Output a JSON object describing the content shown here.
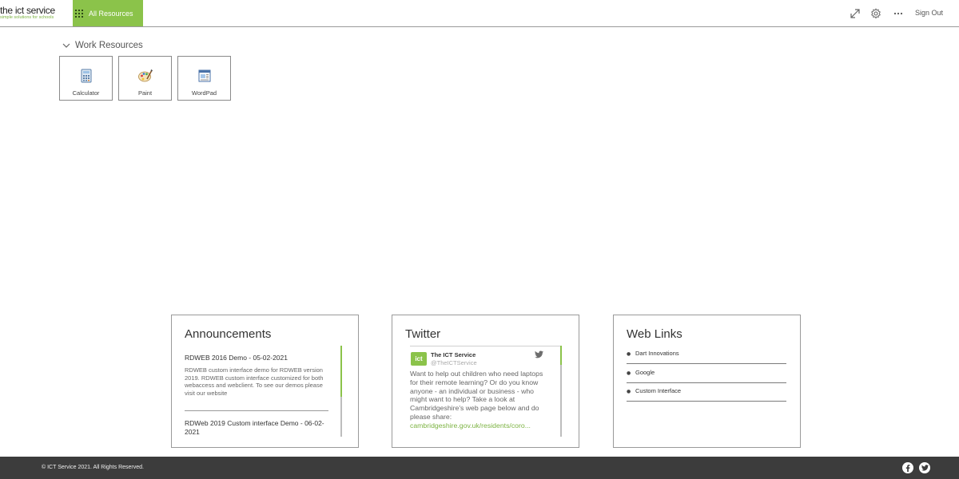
{
  "header": {
    "logo_text": "the ict service",
    "logo_tagline": "simple solutions for schools",
    "all_resources_label": "All Resources",
    "sign_out_label": "Sign Out",
    "icons": [
      "expand-icon",
      "gear-icon",
      "more-icon"
    ]
  },
  "work_resources": {
    "title": "Work Resources",
    "apps": [
      {
        "label": "Calculator",
        "icon": "calculator-icon"
      },
      {
        "label": "Paint",
        "icon": "paint-palette-icon"
      },
      {
        "label": "WordPad",
        "icon": "wordpad-icon"
      }
    ]
  },
  "announcements": {
    "title": "Announcements",
    "items": [
      {
        "title": "RDWEB 2016 Demo - 05-02-2021",
        "text": "RDWEB custom interface demo for RDWEB version 2019. RDWEB custom interface customized for both webaccess and webclient. To see our demos please visit our website"
      },
      {
        "title": "RDWeb 2019 Custom interface Demo - 06-02-2021"
      }
    ]
  },
  "twitter": {
    "title": "Twitter",
    "account_name": "The ICT Service",
    "handle": "@TheICTService",
    "avatar_text": "ict",
    "tweet_text": "Want to help out children who need laptops for their remote learning? Or do you know anyone - an individual or business - who might want to help? Take a look at Cambridgeshire's web page below and do please share:",
    "tweet_link": "cambridgeshire.gov.uk/residents/coro..."
  },
  "web_links": {
    "title": "Web Links",
    "items": [
      {
        "label": "Dart Innovations"
      },
      {
        "label": "Google"
      },
      {
        "label": "Custom Interface"
      }
    ]
  },
  "footer": {
    "copyright": "© ICT Service 2021. All Rights Reserved.",
    "social": [
      "facebook-icon",
      "twitter-icon"
    ]
  },
  "colors": {
    "accent": "#8bc34a",
    "footer_bg": "#3c3c3c"
  }
}
